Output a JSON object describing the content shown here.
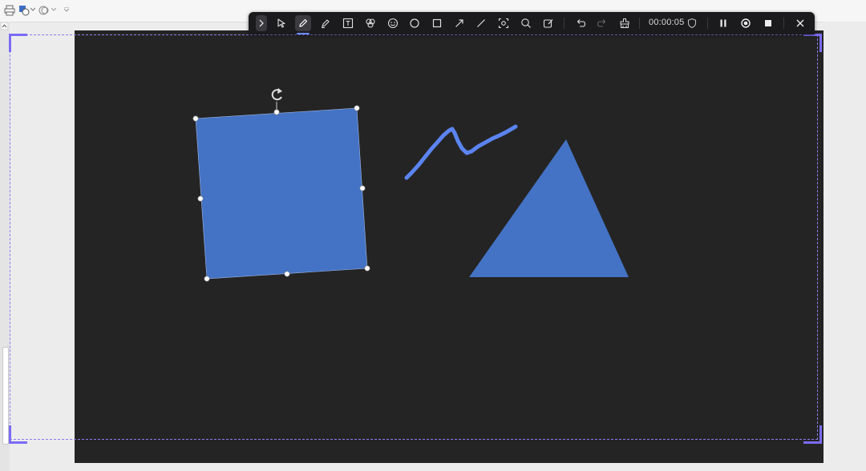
{
  "app": {
    "toolbar": {
      "timer": "00:00:05",
      "tools": [
        {
          "name": "expand-toggle-button",
          "icon": "chevron-right-icon"
        },
        {
          "name": "select-tool",
          "icon": "cursor-arrow-icon"
        },
        {
          "name": "pen-tool",
          "icon": "pen-icon",
          "active": true
        },
        {
          "name": "highlighter-tool",
          "icon": "highlighter-icon"
        },
        {
          "name": "text-tool",
          "icon": "text-box-icon"
        },
        {
          "name": "color-tool",
          "icon": "palette-icon"
        },
        {
          "name": "sticker-tool",
          "icon": "smiley-icon"
        },
        {
          "name": "ellipse-tool",
          "icon": "circle-icon"
        },
        {
          "name": "rectangle-tool",
          "icon": "square-icon"
        },
        {
          "name": "arrow-tool",
          "icon": "arrow-icon"
        },
        {
          "name": "line-tool",
          "icon": "line-icon"
        },
        {
          "name": "spotlight-tool",
          "icon": "spotlight-icon"
        },
        {
          "name": "magnifier-tool",
          "icon": "magnifier-icon"
        },
        {
          "name": "erase-shape-tool",
          "icon": "shape-eraser-icon"
        },
        {
          "name": "undo-button",
          "icon": "undo-icon"
        },
        {
          "name": "redo-button",
          "icon": "redo-icon",
          "disabled": true
        },
        {
          "name": "clear-button",
          "icon": "eraser-icon"
        },
        {
          "name": "shield-button",
          "icon": "shield-icon"
        },
        {
          "name": "pause-button",
          "icon": "pause-icon"
        },
        {
          "name": "record-button",
          "icon": "record-icon"
        },
        {
          "name": "stop-button",
          "icon": "stop-icon"
        },
        {
          "name": "close-button",
          "icon": "close-icon"
        }
      ]
    },
    "colors": {
      "canvas": "#242424",
      "shape_fill": "#4472c4",
      "pen_stroke": "#5b84f0",
      "selection_handle": "#ffffff",
      "region_border": "#7b6cf6"
    },
    "annotations": [
      {
        "type": "rectangle",
        "selected": true,
        "rotated": true
      },
      {
        "type": "freehand-stroke"
      },
      {
        "type": "triangle"
      }
    ]
  }
}
